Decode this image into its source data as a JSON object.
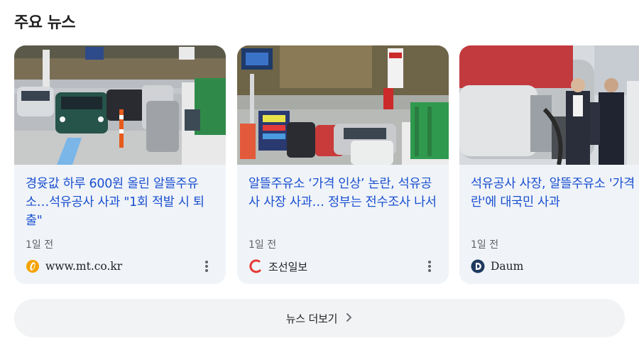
{
  "section": {
    "title": "주요 뉴스"
  },
  "articles": [
    {
      "headline": "경윳값 하루 600원 올린 알뜰주유소…석유공사 사과 \"1회 적발 시 퇴출\"",
      "time": "1일 전",
      "source": "www.mt.co.kr",
      "source_icon": "mt-logo-icon",
      "source_color": "#f5a300"
    },
    {
      "headline": "알뜰주유소 ‘가격 인상’ 논란, 석유공사 사장 사과… 정부는 전수조사 나서",
      "time": "1일 전",
      "source": "조선일보",
      "source_icon": "chosun-logo-icon",
      "source_color": "#e53935"
    },
    {
      "headline": "석유공사 사장, 알뜰주유소 '가격 인상 논란'에 대국민 사과",
      "time": "1일 전",
      "source": "Daum",
      "source_icon": "daum-logo-icon",
      "source_color": "#1f3a5f"
    }
  ],
  "more": {
    "label": "뉴스 더보기"
  },
  "colors": {
    "headline": "#1a4fd0",
    "card_bg": "#f0f4f8",
    "button_bg": "#f1f3f4"
  }
}
